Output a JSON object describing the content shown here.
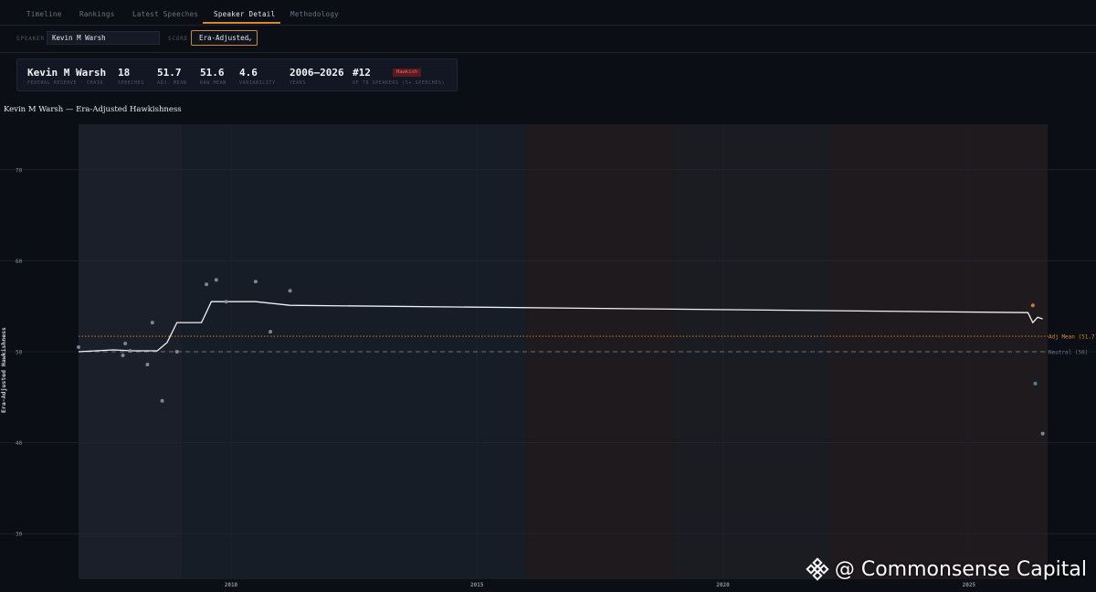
{
  "nav": {
    "tabs": [
      {
        "label": "Timeline"
      },
      {
        "label": "Rankings"
      },
      {
        "label": "Latest Speeches"
      },
      {
        "label": "Speaker Detail"
      },
      {
        "label": "Methodology"
      }
    ],
    "active": "Speaker Detail"
  },
  "controls": {
    "speaker_label": "SPEAKER",
    "speaker_value": "Kevin M Warsh",
    "score_label": "SCORE",
    "score_value": "Era-Adjusted"
  },
  "stats": {
    "name": "Kevin M Warsh",
    "role": "FEDERAL RESERVE · CHAIR",
    "speeches": "18",
    "speeches_label": "SPEECHES",
    "adj_mean": "51.7",
    "adj_mean_label": "ADJ. MEAN",
    "raw_mean": "51.6",
    "raw_mean_label": "RAW MEAN",
    "variability": "4.6",
    "variability_label": "VARIABILITY",
    "years": "2006–2026",
    "years_label": "YEARS",
    "rank": "#12",
    "rank_label": "OF 78 SPEAKERS (5+ SPEECHES)",
    "badge": "Hawkish"
  },
  "chart_title": "Kevin M Warsh — Era-Adjusted Hawkishness",
  "colors": {
    "background": "#0b0e14",
    "accent": "#d98a2b",
    "line": "#f0f2f5",
    "point": "#8b919c",
    "badge_bg": "#5a1a20",
    "badge_text": "#ef6b6b",
    "neutral_line": "#6b7384"
  },
  "chart_data": {
    "type": "line",
    "title": "Kevin M Warsh — Era-Adjusted Hawkishness",
    "ylabel": "Era-Adjusted Hawkishness",
    "xlabel": "",
    "xlim": [
      2006.9,
      2026.6
    ],
    "ylim": [
      25,
      75
    ],
    "x_ticks": [
      2010,
      2015,
      2020,
      2025
    ],
    "y_ticks": [
      30,
      40,
      50,
      60,
      70
    ],
    "grid": true,
    "era_bands": [
      {
        "start": 2006.9,
        "end": 2009.0,
        "color": "#1a1f29"
      },
      {
        "start": 2009.0,
        "end": 2016.0,
        "color": "#161d27"
      },
      {
        "start": 2016.0,
        "end": 2019.0,
        "color": "#1e1a1d"
      },
      {
        "start": 2019.0,
        "end": 2022.2,
        "color": "#1a1c22"
      },
      {
        "start": 2022.2,
        "end": 2026.6,
        "color": "#1e1a1d"
      }
    ],
    "points": [
      {
        "x": 2006.9,
        "y": 50.5,
        "color": "#8b919c"
      },
      {
        "x": 2007.8,
        "y": 49.6,
        "color": "#8b919c"
      },
      {
        "x": 2007.85,
        "y": 50.9,
        "color": "#8b919c"
      },
      {
        "x": 2007.95,
        "y": 50.1,
        "color": "#8b919c"
      },
      {
        "x": 2008.3,
        "y": 48.6,
        "color": "#8b919c"
      },
      {
        "x": 2008.4,
        "y": 53.2,
        "color": "#8b919c"
      },
      {
        "x": 2008.6,
        "y": 44.6,
        "color": "#8b919c"
      },
      {
        "x": 2008.9,
        "y": 50.0,
        "color": "#8b919c"
      },
      {
        "x": 2009.5,
        "y": 57.4,
        "color": "#8b919c"
      },
      {
        "x": 2009.7,
        "y": 57.9,
        "color": "#8b919c"
      },
      {
        "x": 2009.9,
        "y": 55.5,
        "color": "#8b919c"
      },
      {
        "x": 2010.5,
        "y": 57.7,
        "color": "#8b919c"
      },
      {
        "x": 2010.8,
        "y": 52.2,
        "color": "#8b919c"
      },
      {
        "x": 2011.2,
        "y": 56.7,
        "color": "#8b919c"
      },
      {
        "x": 2026.3,
        "y": 55.1,
        "color": "#d98a2b"
      },
      {
        "x": 2026.35,
        "y": 46.5,
        "color": "#4f8fb0"
      },
      {
        "x": 2026.5,
        "y": 41.0,
        "color": "#8b919c"
      }
    ],
    "rolling": {
      "x": [
        2006.9,
        2007.6,
        2008.0,
        2008.5,
        2008.7,
        2008.9,
        2009.4,
        2009.6,
        2010.5,
        2011.2,
        2026.2,
        2026.3,
        2026.4,
        2026.5
      ],
      "y": [
        50.0,
        50.2,
        50.1,
        50.1,
        51.0,
        53.2,
        53.2,
        55.5,
        55.5,
        55.1,
        54.3,
        53.2,
        53.8,
        53.6
      ]
    },
    "reference_lines": [
      {
        "y": 51.7,
        "label": "Adj Mean (51.7)",
        "color": "#d98a2b",
        "style": "dotted"
      },
      {
        "y": 50,
        "label": "Neutral (50)",
        "color": "#6b7384",
        "style": "dashed"
      }
    ]
  },
  "watermark": "@ Commonsense Capital"
}
